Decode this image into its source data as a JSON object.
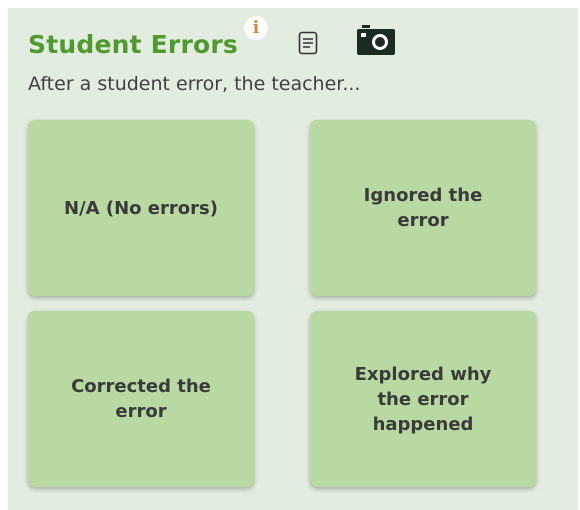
{
  "header": {
    "title": "Student Errors",
    "info_glyph": "i",
    "icons": {
      "info": "info-icon",
      "notes": "document-icon",
      "screenshot": "camera-icon"
    },
    "colors": {
      "title": "#4f9a2e",
      "info": "#d2873a",
      "card": "#b8d9a2",
      "panel": "#e3ece0"
    }
  },
  "prompt": "After a student error, the teacher...",
  "options": [
    {
      "label": "N/A (No errors)"
    },
    {
      "label": "Ignored the error"
    },
    {
      "label": "Corrected the error"
    },
    {
      "label": "Explored why the error happened"
    }
  ]
}
